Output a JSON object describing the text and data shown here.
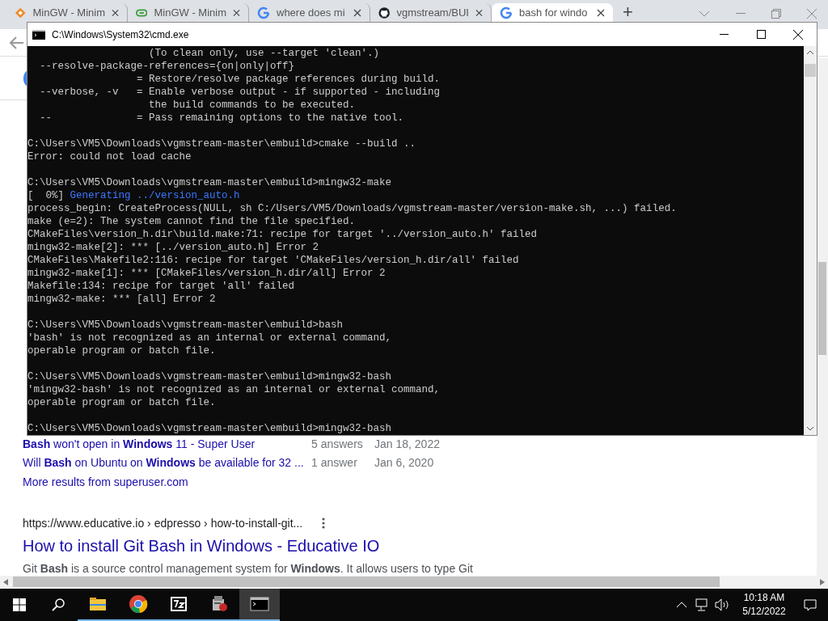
{
  "browser": {
    "tabs": [
      {
        "label": "MinGW - Minim",
        "kind": "diamond",
        "selected": false
      },
      {
        "label": "MinGW - Minim",
        "kind": "oval",
        "selected": false
      },
      {
        "label": "where does mi",
        "kind": "google",
        "selected": false
      },
      {
        "label": "vgmstream/BUI",
        "kind": "github",
        "selected": false
      },
      {
        "label": "bash for windo",
        "kind": "google",
        "selected": true
      }
    ],
    "new_tab": "+",
    "related": [
      {
        "question": "**Bash** won't open in **Windows** 11 - Super User",
        "answers": "5 answers",
        "date": "Jan 18, 2022"
      },
      {
        "question": "Will **Bash** on Ubuntu on **Windows** be available for 32 ...",
        "answers": "1 answer",
        "date": "Jan 6, 2020"
      }
    ],
    "more_results": "More results from superuser.com",
    "result": {
      "url": "https://www.educative.io › edpresso › how-to-install-git...",
      "title": "How to install Git Bash in Windows - Educative IO",
      "snippet": "Git **Bash** is a source control management system for **Windows**. It allows users to type Git"
    }
  },
  "console": {
    "title": "C:\\Windows\\System32\\cmd.exe",
    "blocks": [
      [
        {
          "text": "                    (To clean only, use --target 'clean'.)"
        },
        {
          "text": "  --resolve-package-references={on|only|off}"
        },
        {
          "text": "                  = Restore/resolve package references during build."
        },
        {
          "text": "  --verbose, -v   = Enable verbose output - if supported - including"
        },
        {
          "text": "                    the build commands to be executed."
        },
        {
          "text": "  --              = Pass remaining options to the native tool."
        }
      ],
      [
        {
          "text": "C:\\Users\\VM5\\Downloads\\vgmstream-master\\embuild>cmake --build .."
        },
        {
          "text": "Error: could not load cache"
        }
      ],
      [
        {
          "text": "C:\\Users\\VM5\\Downloads\\vgmstream-master\\embuild>mingw32-make"
        },
        {
          "text": "[  0%] ",
          "highlight": "Generating ../version_auto.h"
        },
        {
          "text": "process_begin: CreateProcess(NULL, sh C:/Users/VM5/Downloads/vgmstream-master/version-make.sh, ...) failed."
        },
        {
          "text": "make (e=2): The system cannot find the file specified."
        },
        {
          "text": "CMakeFiles\\version_h.dir\\build.make:71: recipe for target '../version_auto.h' failed"
        },
        {
          "text": "mingw32-make[2]: *** [../version_auto.h] Error 2"
        },
        {
          "text": "CMakeFiles\\Makefile2:116: recipe for target 'CMakeFiles/version_h.dir/all' failed"
        },
        {
          "text": "mingw32-make[1]: *** [CMakeFiles/version_h.dir/all] Error 2"
        },
        {
          "text": "Makefile:134: recipe for target 'all' failed"
        },
        {
          "text": "mingw32-make: *** [all] Error 2"
        }
      ],
      [
        {
          "text": "C:\\Users\\VM5\\Downloads\\vgmstream-master\\embuild>bash"
        },
        {
          "text": "'bash' is not recognized as an internal or external command,"
        },
        {
          "text": "operable program or batch file."
        }
      ],
      [
        {
          "text": "C:\\Users\\VM5\\Downloads\\vgmstream-master\\embuild>mingw32-bash"
        },
        {
          "text": "'mingw32-bash' is not recognized as an internal or external command,"
        },
        {
          "text": "operable program or batch file."
        }
      ],
      [
        {
          "text": "C:\\Users\\VM5\\Downloads\\vgmstream-master\\embuild>mingw32-bash"
        }
      ]
    ]
  },
  "taskbar": {
    "apps": [
      {
        "kind": "explorer",
        "selected": false
      },
      {
        "kind": "chrome",
        "selected": false
      },
      {
        "kind": "archive",
        "selected": false
      },
      {
        "kind": "installer",
        "selected": false
      },
      {
        "kind": "cmd",
        "selected": true
      }
    ],
    "time": "10:18 AM",
    "date": "5/12/2022"
  }
}
